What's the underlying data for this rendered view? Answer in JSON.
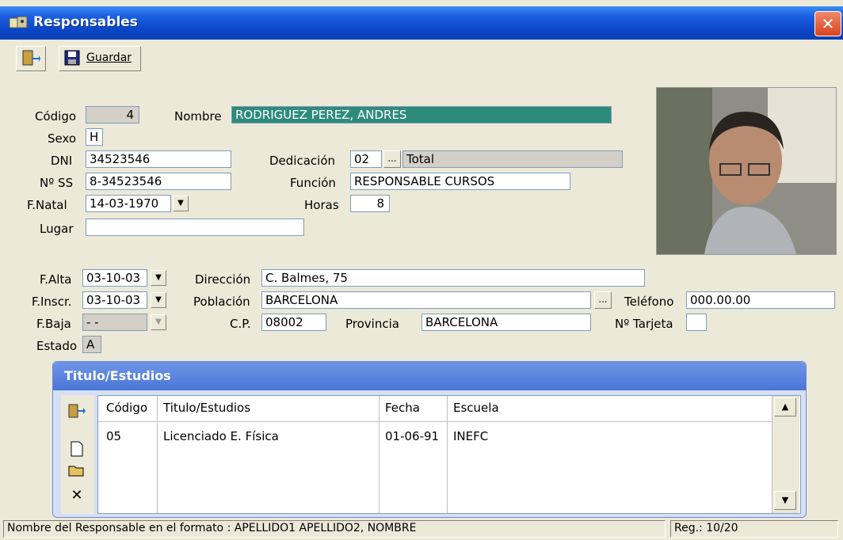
{
  "window": {
    "title": "Responsables",
    "close": "✕"
  },
  "toolbar": {
    "save_label": "Guardar"
  },
  "form": {
    "codigo_label": "Código",
    "codigo_value": "4",
    "nombre_label": "Nombre",
    "nombre_value": "RODRIGUEZ PEREZ, ANDRES",
    "sexo_label": "Sexo",
    "sexo_value": "H",
    "dni_label": "DNI",
    "dni_value": "34523546",
    "nss_label": "Nº SS",
    "nss_value": "8-34523546",
    "fnatal_label": "F.Natal",
    "fnatal_value": "14-03-1970",
    "lugar_label": "Lugar",
    "lugar_value": "",
    "dedicacion_label": "Dedicación",
    "dedicacion_code": "02",
    "dedicacion_value": "Total",
    "funcion_label": "Función",
    "funcion_value": "RESPONSABLE CURSOS",
    "horas_label": "Horas",
    "horas_value": "8",
    "falta_label": "F.Alta",
    "falta_value": "03-10-03",
    "finscr_label": "F.Inscr.",
    "finscr_value": "03-10-03",
    "fbaja_label": "F.Baja",
    "fbaja_value": "- -",
    "estado_label": "Estado",
    "estado_value": "A",
    "direccion_label": "Dirección",
    "direccion_value": "C. Balmes, 75",
    "poblacion_label": "Población",
    "poblacion_value": "BARCELONA",
    "cp_label": "C.P.",
    "cp_value": "08002",
    "provincia_label": "Provincia",
    "provincia_value": "BARCELONA",
    "telefono_label": "Teléfono",
    "telefono_value": "000.00.00",
    "tarjeta_label": "Nº Tarjeta",
    "tarjeta_value": ""
  },
  "studies": {
    "title": "Titulo/Estudios",
    "columns": [
      "Código",
      "Titulo/Estudios",
      "Fecha",
      "Escuela"
    ],
    "rows": [
      {
        "codigo": "05",
        "titulo": "Licenciado E. Física",
        "fecha": "01-06-91",
        "escuela": "INEFC"
      }
    ]
  },
  "status": {
    "hint": "Nombre del Responsable en el formato : APELLIDO1 APELLIDO2, NOMBRE",
    "record": "Reg.: 10/20"
  },
  "colors": {
    "titlebar": "#0b46c8",
    "selected_field": "#2e8b7a",
    "group_header": "#5a82dc"
  }
}
